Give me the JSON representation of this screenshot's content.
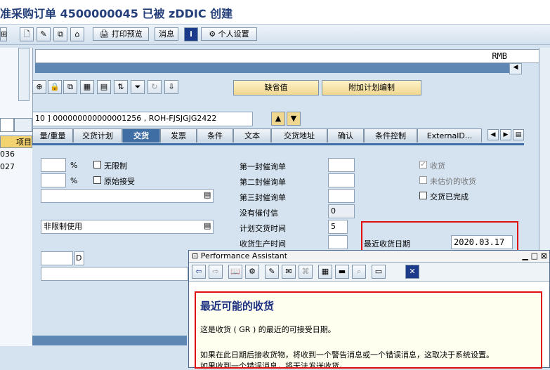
{
  "title": "准采购订单 4500000045 已被 zDDIC 创建",
  "toolbar": {
    "print_preview": "打印预览",
    "messages": "消息",
    "personal_settings": "个人设置"
  },
  "currency": "RMB",
  "actions": {
    "default_values": "缺省值",
    "additional_planning": "附加计划编制"
  },
  "item_field": "10 ] 000000000000001256 , ROH-FJSJGJG2422",
  "left_panel": {
    "label": "项目",
    "rows": [
      "036",
      "027"
    ]
  },
  "tabs": [
    "量/重量",
    "交货计划",
    "交货",
    "发票",
    "条件",
    "文本",
    "交货地址",
    "确认",
    "条件控制",
    "ExternalD..."
  ],
  "active_tab": "交货",
  "delivery": {
    "pct_unit_1": "%",
    "pct_unit_2": "%",
    "unlimited": "无限制",
    "original_accept": "原始接受",
    "stock_type": "非限制使用",
    "unit_d": "D",
    "reminder1": "第一封催询单",
    "reminder2": "第二封催询单",
    "reminder3": "第三封催询单",
    "no_expediter": "没有催付信",
    "no_expediter_value": "0",
    "planned_delivery_time": "计划交货时间",
    "planned_delivery_value": "5",
    "gr_processing_time": "收货生产时间",
    "goods_receipt": "收货",
    "non_valuated_gr": "未估价的收货",
    "delivery_completed": "交货已完成",
    "latest_gr_date_label": "最近收货日期",
    "latest_gr_date_value": "2020.03.17"
  },
  "performance_assistant": {
    "window_title": "Performance Assistant",
    "heading": "最近可能的收货",
    "para1": "这是收货 ( GR ) 的最近的可接受日期。",
    "para2": "如果在此日期后接收货物，将收到一个警告消息或一个错误消息，这取决于系统设置。",
    "para3": "如果收到一个错误消息，将无法发送收货。"
  },
  "colors": {
    "active_tab": "#3f6ea5",
    "highlight": "#e01010",
    "title": "#233e78"
  }
}
